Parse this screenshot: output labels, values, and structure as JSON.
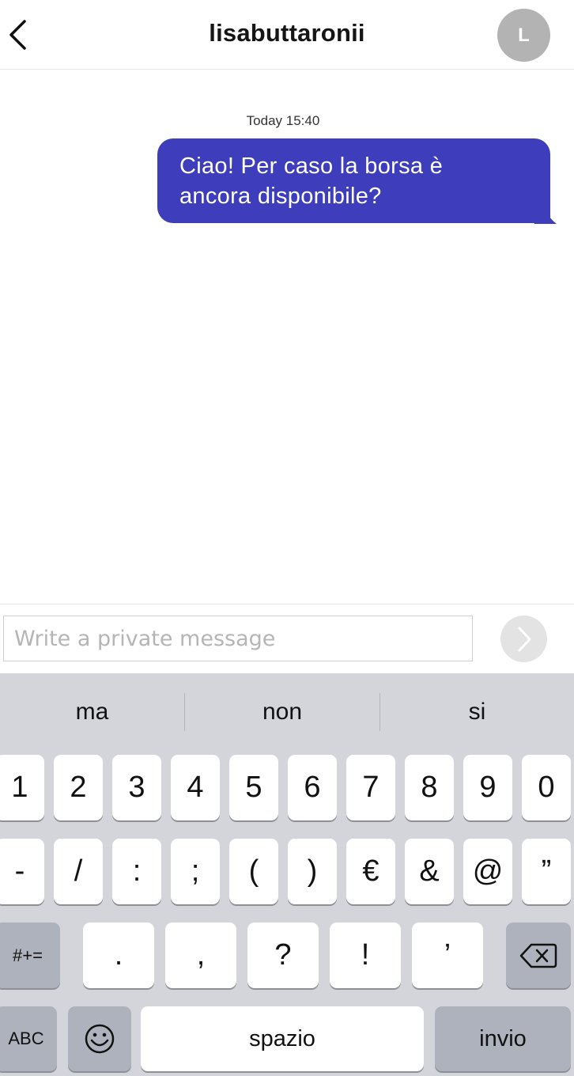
{
  "header": {
    "title": "lisabuttaronii",
    "avatar_initial": "L"
  },
  "conversation": {
    "timestamp": "Today 15:40",
    "messages": [
      {
        "line1": "Ciao! Per caso la borsa è",
        "line2": "ancora disponibile?"
      }
    ]
  },
  "composer": {
    "placeholder": "Write a private message"
  },
  "keyboard": {
    "suggestions": [
      "ma",
      "non",
      "si"
    ],
    "row1": [
      "1",
      "2",
      "3",
      "4",
      "5",
      "6",
      "7",
      "8",
      "9",
      "0"
    ],
    "row2": [
      "-",
      "/",
      ":",
      ";",
      "(",
      ")",
      "€",
      "&",
      "@",
      "”"
    ],
    "row3_mode": "#+=",
    "row3": [
      ".",
      ",",
      "?",
      "!",
      "’"
    ],
    "abc_label": "ABC",
    "space_label": "spazio",
    "return_label": "invio"
  },
  "colors": {
    "bubble": "#3e3ebd",
    "avatar": "#b3b3b3",
    "keyboard_bg": "#d4d5db",
    "key_dark": "#aeb2bd"
  }
}
